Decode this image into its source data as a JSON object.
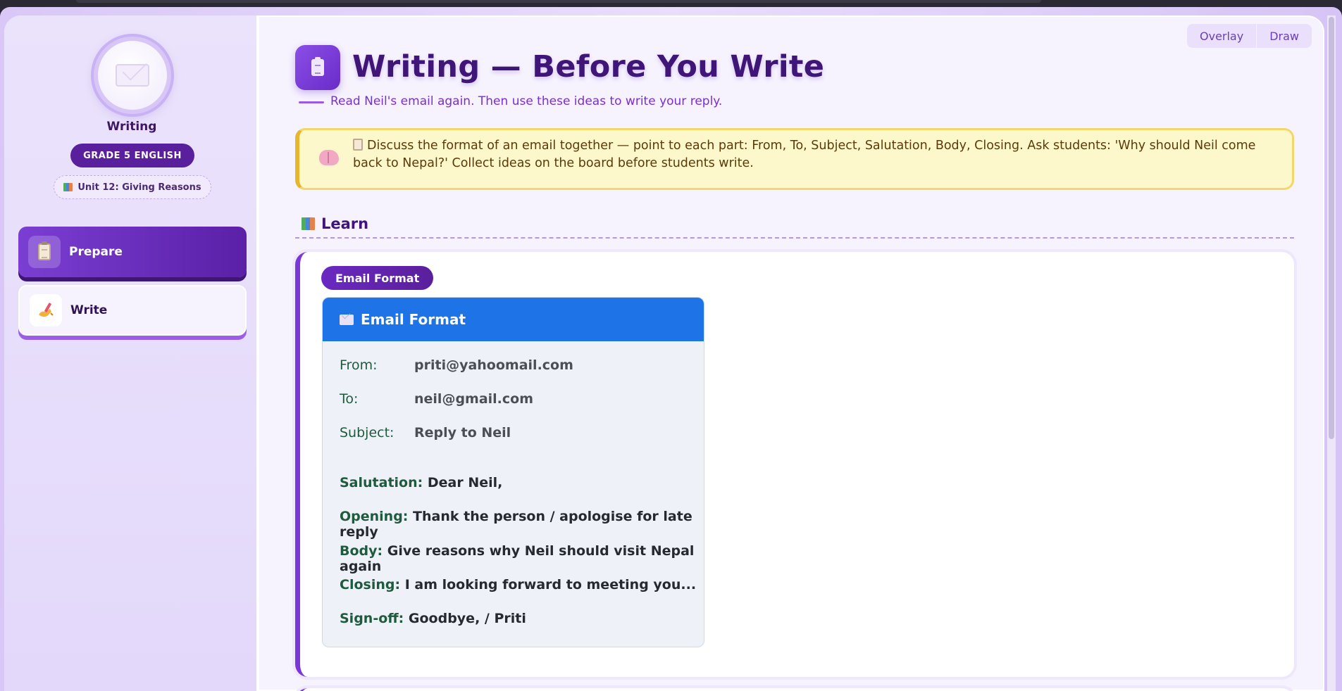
{
  "toolbar": {
    "overlay_label": "Overlay",
    "draw_label": "Draw"
  },
  "sidebar": {
    "title": "Writing",
    "grade": "GRADE 5 ENGLISH",
    "unit": "Unit 12: Giving Reasons",
    "items": [
      {
        "label": "Prepare",
        "icon": "clipboard-icon",
        "active": true
      },
      {
        "label": "Write",
        "icon": "writing-hand-icon",
        "active": false
      }
    ]
  },
  "header": {
    "title": "Writing — Before You Write",
    "subtitle": "Read Neil's email again. Then use these ideas to write your reply."
  },
  "callout": {
    "icon": "brain-icon",
    "text": "Discuss the format of an email together — point to each part: From, To, Subject, Salutation, Body, Closing. Ask students: 'Why should Neil come back to Nepal?' Collect ideas on the board before students write."
  },
  "section": {
    "label": "Learn",
    "icon": "books-icon"
  },
  "card": {
    "badge": "Email Format",
    "email_title": "Email Format",
    "meta": [
      {
        "key": "From:",
        "value": "priti@yahoomail.com"
      },
      {
        "key": "To:",
        "value": "neil@gmail.com"
      },
      {
        "key": "Subject:",
        "value": "Reply to Neil"
      }
    ],
    "parts": [
      {
        "key": "Salutation:",
        "value": "Dear Neil,"
      },
      {
        "key": "Opening:",
        "value": "Thank the person / apologise for late reply"
      },
      {
        "key": "Body:",
        "value": "Give reasons why Neil should visit Nepal again"
      },
      {
        "key": "Closing:",
        "value": "I am looking forward to meeting you..."
      },
      {
        "key": "Sign-off:",
        "value": "Goodbye, / Priti"
      }
    ]
  },
  "colors": {
    "accent": "#5a1f9c",
    "email_header": "#1e73e6",
    "callout_bg": "#fdf8cc",
    "label_green": "#1f5a3d"
  }
}
